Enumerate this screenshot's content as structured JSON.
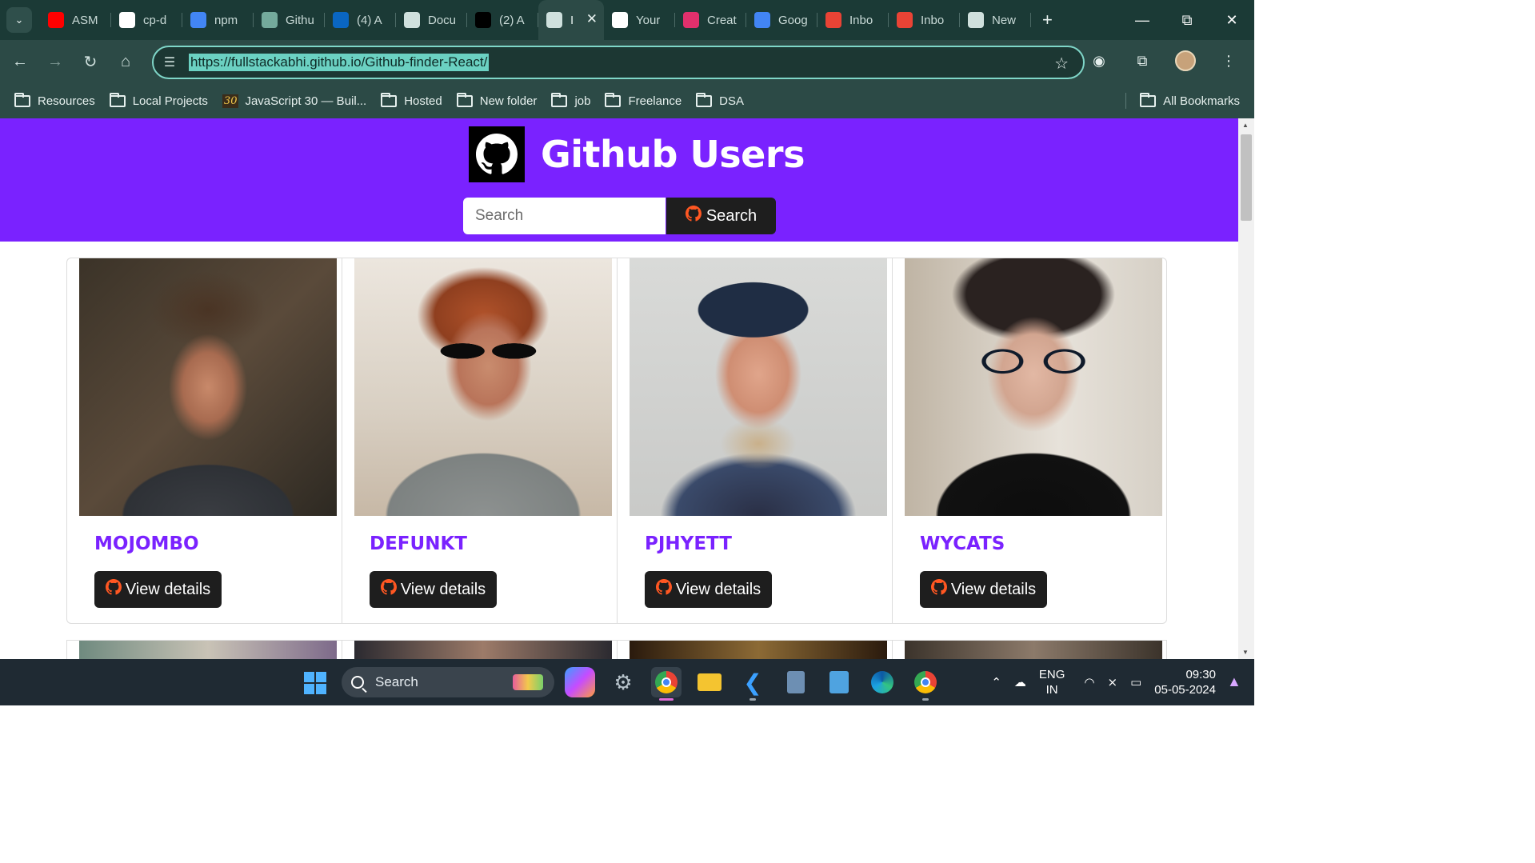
{
  "browser": {
    "tabs": [
      {
        "title": "ASM",
        "favicon": "youtube-icon",
        "color": "#ff0000"
      },
      {
        "title": "cp-d",
        "favicon": "github-icon",
        "color": "#ffffff"
      },
      {
        "title": "npm",
        "favicon": "google-icon",
        "color": "#4285f4"
      },
      {
        "title": "Githu",
        "favicon": "chatgpt-icon",
        "color": "#74aa9c"
      },
      {
        "title": "(4) A",
        "favicon": "linkedin-icon",
        "color": "#0a66c2"
      },
      {
        "title": "Docu",
        "favicon": "globe-icon",
        "color": "#cfe0dd"
      },
      {
        "title": "(2) A",
        "favicon": "x-icon",
        "color": "#000000"
      },
      {
        "title": "I",
        "favicon": "globe-icon",
        "color": "#cfe0dd",
        "active": true
      },
      {
        "title": "Your",
        "favicon": "github-icon",
        "color": "#ffffff"
      },
      {
        "title": "Creat",
        "favicon": "instagram-icon",
        "color": "#e1306c"
      },
      {
        "title": "Goog",
        "favicon": "google-icon",
        "color": "#4285f4"
      },
      {
        "title": "Inbo",
        "favicon": "gmail-icon",
        "color": "#ea4335"
      },
      {
        "title": "Inbo",
        "favicon": "gmail-icon",
        "color": "#ea4335"
      },
      {
        "title": "New",
        "favicon": "chrome-icon",
        "color": "#cfe0dd"
      }
    ],
    "url": "https://fullstackabhi.github.io/Github-finder-React/",
    "bookmarks": [
      {
        "label": "Resources",
        "type": "folder"
      },
      {
        "label": "Local Projects",
        "type": "folder"
      },
      {
        "label": "JavaScript 30 — Buil...",
        "type": "js30",
        "badge": "30"
      },
      {
        "label": "Hosted",
        "type": "folder"
      },
      {
        "label": "New folder",
        "type": "folder"
      },
      {
        "label": "job",
        "type": "folder"
      },
      {
        "label": "Freelance",
        "type": "folder"
      },
      {
        "label": "DSA",
        "type": "folder"
      }
    ],
    "all_bookmarks": "All Bookmarks"
  },
  "app": {
    "title": "Github Users",
    "accent": "#7a22ff",
    "search": {
      "placeholder": "Search",
      "button_label": "Search"
    },
    "users": [
      {
        "login": "mojombo",
        "button_label": "View details"
      },
      {
        "login": "defunkt",
        "button_label": "View details"
      },
      {
        "login": "pjhyett",
        "button_label": "View details"
      },
      {
        "login": "wycats",
        "button_label": "View details"
      }
    ]
  },
  "taskbar": {
    "search_placeholder": "Search",
    "language_line1": "ENG",
    "language_line2": "IN",
    "time": "09:30",
    "date": "05-05-2024"
  }
}
